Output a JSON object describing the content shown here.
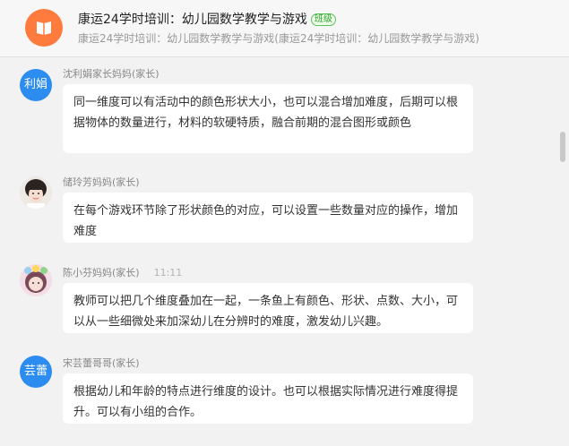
{
  "header": {
    "title": "康运24学时培训：幼儿园数学教学与游戏",
    "tag": "班级",
    "subtitle": "康运24学时培训：幼儿园数学教学与游戏(康运24学时培训：幼儿园数学教学与游戏)"
  },
  "messages": [
    {
      "avatar_text": "利娟",
      "name": "沈利娟家长妈妈(家长)",
      "time": "",
      "text": "同一维度可以有活动中的颜色形状大小，也可以混合增加难度，后期可以根据物体的数量进行，材料的软硬特质，融合前期的混合图形或颜色"
    },
    {
      "avatar_text": "",
      "name": "储玲芳妈妈(家长)",
      "time": "",
      "text": "在每个游戏环节除了形状颜色的对应，可以设置一些数量对应的操作，增加难度"
    },
    {
      "avatar_text": "",
      "name": "陈小芬妈妈(家长)",
      "time": "11:11",
      "text": "教师可以把几个维度叠加在一起，一条鱼上有颜色、形状、点数、大小，可以从一些细微处来加深幼儿在分辨时的难度，激发幼儿兴趣。"
    },
    {
      "avatar_text": "芸蕾",
      "name": "宋芸蕾哥哥(家长)",
      "time": "",
      "text": "根据幼儿和年龄的特点进行维度的设计。也可以根据实际情况进行难度得提升。可以有小组的合作。"
    }
  ],
  "colors": {
    "accent_blue": "#2d8cf0",
    "logo_orange": "#ff7a3d",
    "tag_green": "#59c159"
  }
}
